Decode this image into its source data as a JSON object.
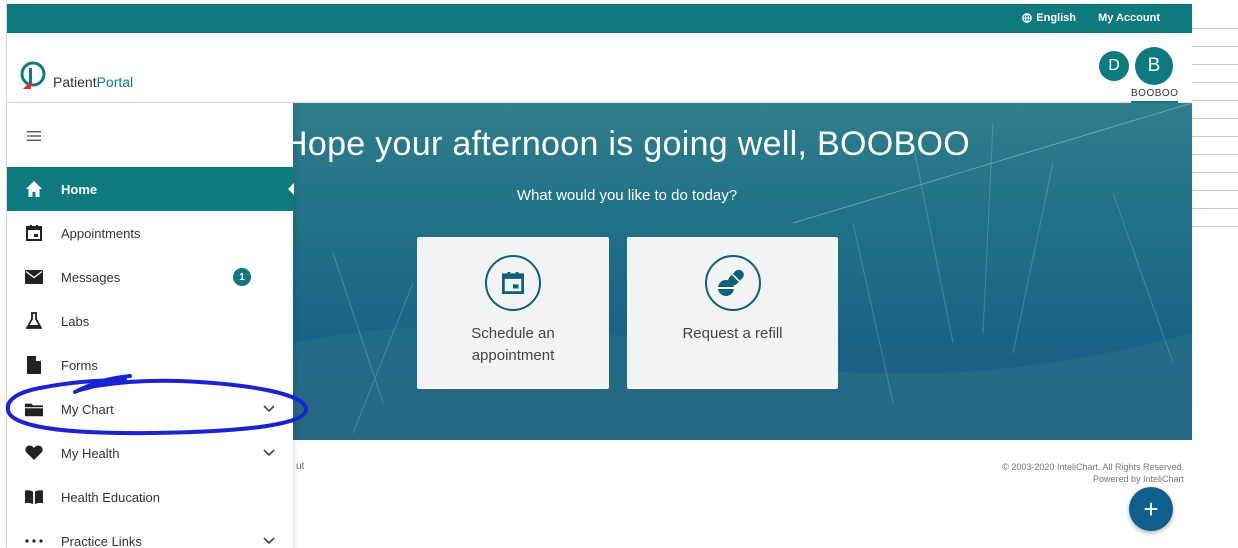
{
  "topbar": {
    "language": "English",
    "account": "My Account"
  },
  "header": {
    "brand_part1": "Patient",
    "brand_part2": "Portal",
    "avatar_small": "D",
    "avatar_large": "B",
    "user_name": "BOOBOO"
  },
  "sidebar": {
    "items": [
      {
        "label": "Home",
        "icon": "home-icon"
      },
      {
        "label": "Appointments",
        "icon": "calendar-icon"
      },
      {
        "label": "Messages",
        "icon": "mail-icon",
        "badge": "1"
      },
      {
        "label": "Labs",
        "icon": "flask-icon"
      },
      {
        "label": "Forms",
        "icon": "document-icon"
      },
      {
        "label": "My Chart",
        "icon": "folder-icon"
      },
      {
        "label": "My Health",
        "icon": "heart-icon"
      },
      {
        "label": "Health Education",
        "icon": "book-icon"
      },
      {
        "label": "Practice Links",
        "icon": "dots-icon"
      }
    ]
  },
  "hero": {
    "greeting": "Hope your afternoon is going well, BOOBOO",
    "subtitle": "What would you like to do today?",
    "cards": [
      {
        "label": "Schedule an appointment"
      },
      {
        "label": "Request a refill"
      }
    ]
  },
  "footer": {
    "left": "ut",
    "copyright": "© 2003-2020 InteliChart. All Rights Reserved.",
    "powered": "Powered by InteliChart"
  },
  "fab_label": "+",
  "colors": {
    "primary": "#0e7a7e",
    "fab": "#0e5f8c",
    "annotation": "#1a22d6"
  }
}
